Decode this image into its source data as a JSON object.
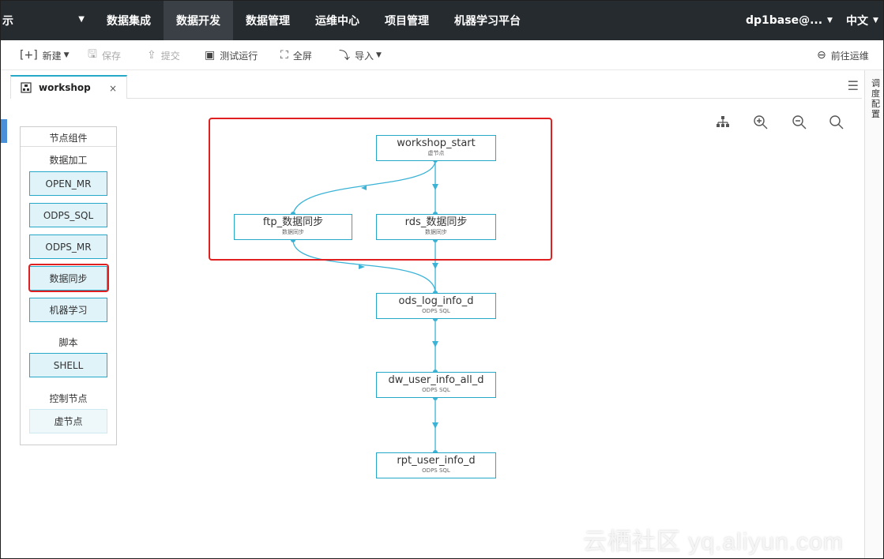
{
  "topnav": {
    "brand": "示",
    "menu": [
      "数据集成",
      "数据开发",
      "数据管理",
      "运维中心",
      "项目管理",
      "机器学习平台"
    ],
    "active_index": 1,
    "user": "dp1base@...",
    "language": "中文"
  },
  "toolbar": {
    "new": "新建",
    "save": "保存",
    "submit": "提交",
    "test_run": "测试运行",
    "fullscreen": "全屏",
    "import": "导入",
    "goto_ops": "前往运维"
  },
  "editor_tab": {
    "title": "workshop",
    "close": "×"
  },
  "right_panel": {
    "label": "调度配置"
  },
  "palette": {
    "title": "节点组件",
    "sections": [
      {
        "label": "数据加工",
        "items": [
          "OPEN_MR",
          "ODPS_SQL",
          "ODPS_MR",
          "数据同步",
          "机器学习"
        ]
      },
      {
        "label": "脚本",
        "items": [
          "SHELL"
        ]
      },
      {
        "label": "控制节点",
        "items": [
          "虚节点"
        ]
      }
    ]
  },
  "nodes": [
    {
      "name": "workshop_start",
      "type": "虚节点"
    },
    {
      "name": "ftp_数据同步",
      "type": "数据同步"
    },
    {
      "name": "rds_数据同步",
      "type": "数据同步"
    },
    {
      "name": "ods_log_info_d",
      "type": "ODPS SQL"
    },
    {
      "name": "dw_user_info_all_d",
      "type": "ODPS SQL"
    },
    {
      "name": "rpt_user_info_d",
      "type": "ODPS SQL"
    }
  ],
  "colors": {
    "accent": "#26a9c9",
    "nav_bg": "#262b2f",
    "highlight": "#e02020"
  },
  "watermark": "云栖社区 yq.aliyun.com"
}
